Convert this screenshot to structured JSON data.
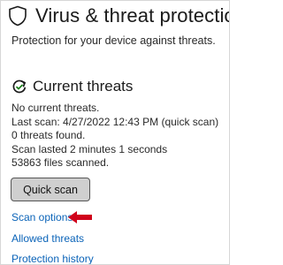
{
  "header": {
    "title": "Virus & threat protection",
    "subtitle": "Protection for your device against threats.",
    "icon": "shield-icon"
  },
  "current_threats": {
    "title": "Current threats",
    "icon": "refresh-icon",
    "lines": [
      "No current threats.",
      "Last scan: 4/27/2022 12:43 PM (quick scan)",
      "0 threats found.",
      "Scan lasted 2 minutes 1 seconds",
      "53863 files scanned."
    ],
    "button_label": "Quick scan"
  },
  "links": {
    "scan_options": "Scan options",
    "allowed_threats": "Allowed threats",
    "protection_history": "Protection history"
  },
  "annotation": {
    "icon": "arrow-left-icon",
    "color": "#d0021b"
  },
  "colors": {
    "link": "#0a63b8",
    "button_bg": "#cfcfcf",
    "arrow": "#d0021b"
  }
}
